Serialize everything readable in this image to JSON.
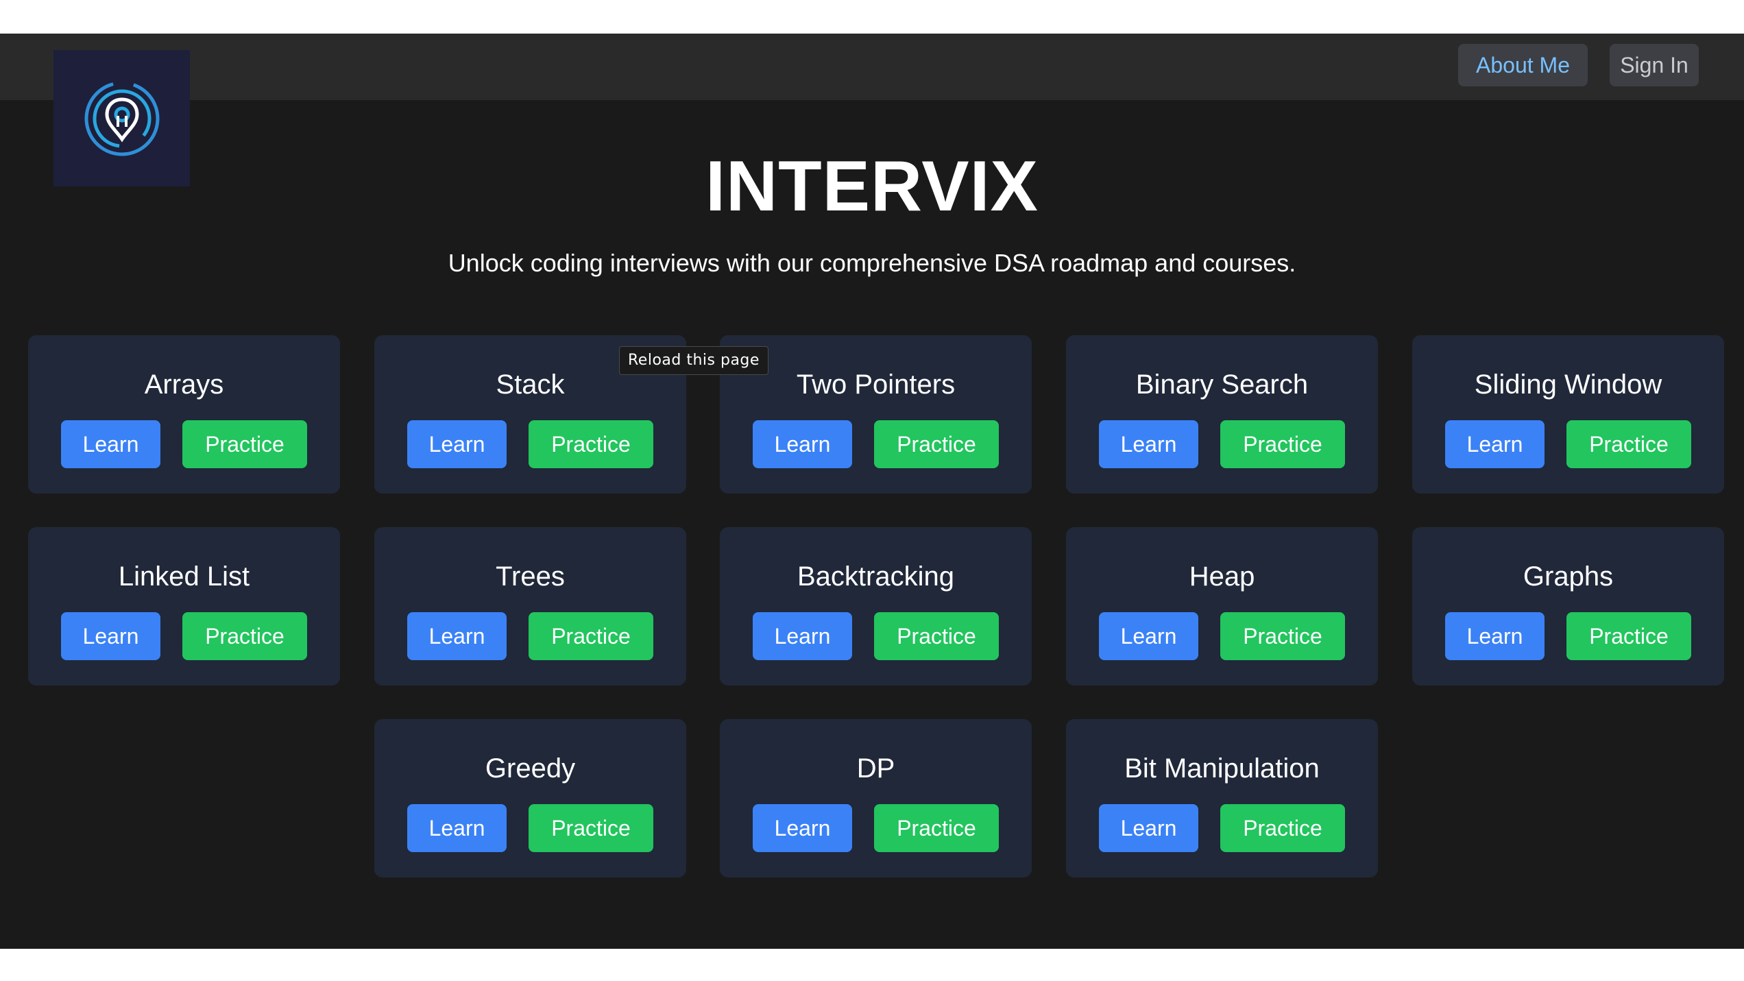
{
  "header": {
    "logo_alt": "Intervix logo",
    "about_label": "About Me",
    "signin_label": "Sign In"
  },
  "hero": {
    "title": "INTERVIX",
    "subtitle": "Unlock coding interviews with our comprehensive DSA roadmap and courses."
  },
  "topics": [
    {
      "title": "Arrays",
      "learn": "Learn",
      "practice": "Practice"
    },
    {
      "title": "Stack",
      "learn": "Learn",
      "practice": "Practice"
    },
    {
      "title": "Two Pointers",
      "learn": "Learn",
      "practice": "Practice"
    },
    {
      "title": "Binary Search",
      "learn": "Learn",
      "practice": "Practice"
    },
    {
      "title": "Sliding Window",
      "learn": "Learn",
      "practice": "Practice"
    },
    {
      "title": "Linked List",
      "learn": "Learn",
      "practice": "Practice"
    },
    {
      "title": "Trees",
      "learn": "Learn",
      "practice": "Practice"
    },
    {
      "title": "Backtracking",
      "learn": "Learn",
      "practice": "Practice"
    },
    {
      "title": "Heap",
      "learn": "Learn",
      "practice": "Practice"
    },
    {
      "title": "Graphs",
      "learn": "Learn",
      "practice": "Practice"
    },
    {
      "title": "Greedy",
      "learn": "Learn",
      "practice": "Practice"
    },
    {
      "title": "DP",
      "learn": "Learn",
      "practice": "Practice"
    },
    {
      "title": "Bit Manipulation",
      "learn": "Learn",
      "practice": "Practice"
    }
  ],
  "tooltip": {
    "text": "Reload this page"
  },
  "colors": {
    "background": "#1a1a1a",
    "navbar": "#2a2a2a",
    "card": "#202839",
    "learn": "#3b82f6",
    "practice": "#22c55e",
    "about_text": "#79c0ff"
  },
  "icons": {
    "logo": "target-pin-icon"
  }
}
